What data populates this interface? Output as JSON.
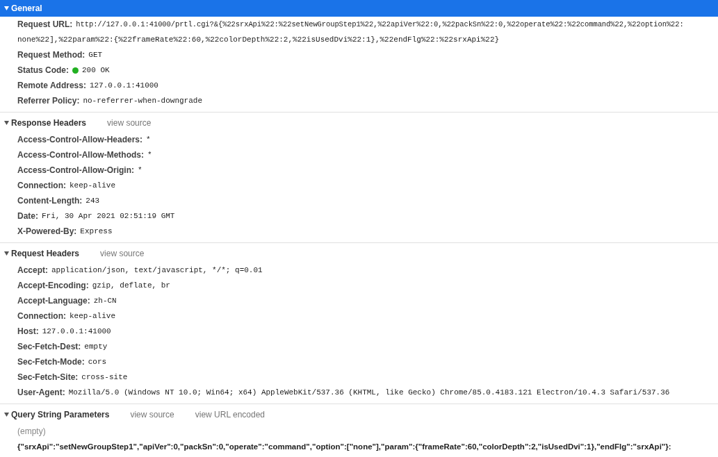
{
  "sections": [
    {
      "title": "General",
      "selected": true,
      "expanded": true,
      "rows": [
        {
          "kind": "wrapped",
          "name": "Request URL:",
          "lines": [
            "http://127.0.0.1:41000/prtl.cgi?&{%22srxApi%22:%22setNewGroupStep1%22,%22apiVer%22:0,%22packSn%22:0,%22operate%22:%22command%22,%22option%22:",
            "none%22],%22param%22:{%22frameRate%22:60,%22colorDepth%22:2,%22isUsedDvi%22:1},%22endFlg%22:%22srxApi%22}"
          ]
        },
        {
          "kind": "header",
          "name": "Request Method:",
          "value": "GET"
        },
        {
          "kind": "status",
          "name": "Status Code:",
          "value": "200 OK",
          "color": "#22b022"
        },
        {
          "kind": "header",
          "name": "Remote Address:",
          "value": "127.0.0.1:41000"
        },
        {
          "kind": "header",
          "name": "Referrer Policy:",
          "value": "no-referrer-when-downgrade"
        }
      ]
    },
    {
      "title": "Response Headers",
      "selected": false,
      "expanded": true,
      "links": [
        "view source"
      ],
      "rows": [
        {
          "kind": "header",
          "name": "Access-Control-Allow-Headers:",
          "value": "*"
        },
        {
          "kind": "header",
          "name": "Access-Control-Allow-Methods:",
          "value": "*"
        },
        {
          "kind": "header",
          "name": "Access-Control-Allow-Origin:",
          "value": "*"
        },
        {
          "kind": "header",
          "name": "Connection:",
          "value": "keep-alive"
        },
        {
          "kind": "header",
          "name": "Content-Length:",
          "value": "243"
        },
        {
          "kind": "header",
          "name": "Date:",
          "value": "Fri, 30 Apr 2021 02:51:19 GMT"
        },
        {
          "kind": "header",
          "name": "X-Powered-By:",
          "value": "Express"
        }
      ]
    },
    {
      "title": "Request Headers",
      "selected": false,
      "expanded": true,
      "links": [
        "view source"
      ],
      "rows": [
        {
          "kind": "header",
          "name": "Accept:",
          "value": "application/json, text/javascript, */*; q=0.01"
        },
        {
          "kind": "header",
          "name": "Accept-Encoding:",
          "value": "gzip, deflate, br"
        },
        {
          "kind": "header",
          "name": "Accept-Language:",
          "value": "zh-CN"
        },
        {
          "kind": "header",
          "name": "Connection:",
          "value": "keep-alive"
        },
        {
          "kind": "header",
          "name": "Host:",
          "value": "127.0.0.1:41000"
        },
        {
          "kind": "header",
          "name": "Sec-Fetch-Dest:",
          "value": "empty"
        },
        {
          "kind": "header",
          "name": "Sec-Fetch-Mode:",
          "value": "cors"
        },
        {
          "kind": "header",
          "name": "Sec-Fetch-Site:",
          "value": "cross-site"
        },
        {
          "kind": "header",
          "name": "User-Agent:",
          "value": "Mozilla/5.0 (Windows NT 10.0; Win64; x64) AppleWebKit/537.36 (KHTML, like Gecko) Chrome/85.0.4183.121 Electron/10.4.3 Safari/537.36"
        }
      ]
    },
    {
      "title": "Query String Parameters",
      "selected": false,
      "expanded": true,
      "links": [
        "view source",
        "view URL encoded"
      ],
      "rows": [
        {
          "kind": "note",
          "value": "(empty)"
        },
        {
          "kind": "param",
          "value": "{\"srxApi\":\"setNewGroupStep1\",\"apiVer\":0,\"packSn\":0,\"operate\":\"command\",\"option\":[\"none\"],\"param\":{\"frameRate\":60,\"colorDepth\":2,\"isUsedDvi\":1},\"endFlg\":\"srxApi\"}:"
        }
      ]
    }
  ]
}
